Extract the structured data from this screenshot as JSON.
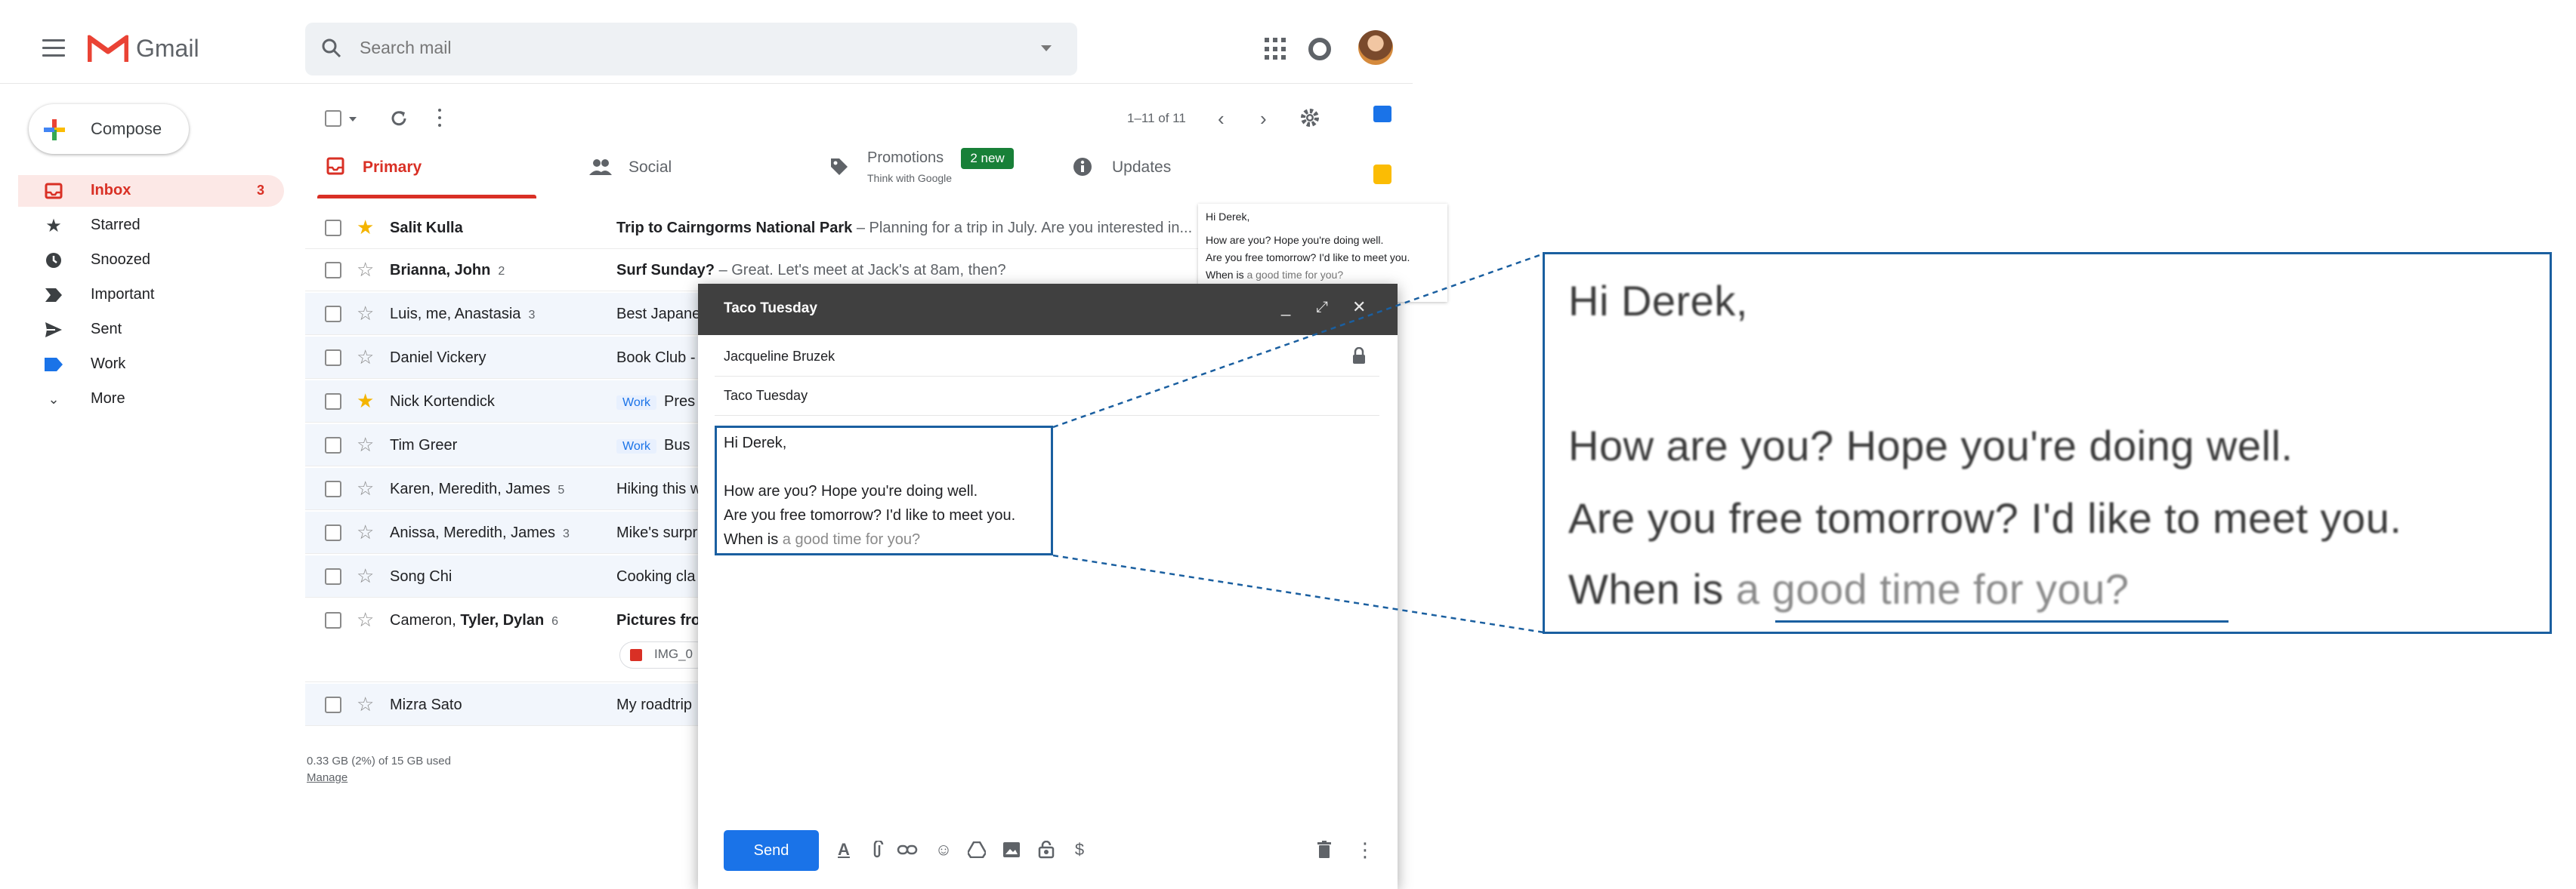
{
  "app": {
    "brand": "Gmail",
    "logo_letter": "M"
  },
  "search": {
    "placeholder": "Search mail"
  },
  "sidebar": {
    "compose_label": "Compose",
    "items": [
      {
        "label": "Inbox",
        "count": "3",
        "icon": "inbox-icon"
      },
      {
        "label": "Starred",
        "icon": "star-icon"
      },
      {
        "label": "Snoozed",
        "icon": "clock-icon"
      },
      {
        "label": "Important",
        "icon": "important-icon"
      },
      {
        "label": "Sent",
        "icon": "send-icon"
      },
      {
        "label": "Work",
        "icon": "label-icon"
      },
      {
        "label": "More",
        "icon": "chevron-down-icon"
      }
    ]
  },
  "toolbar": {
    "pagination": "1–11 of 11"
  },
  "tabs": [
    {
      "label": "Primary"
    },
    {
      "label": "Social"
    },
    {
      "label": "Promotions",
      "badge": "2 new",
      "sub": "Think with Google"
    },
    {
      "label": "Updates"
    }
  ],
  "emails": [
    {
      "sender": "Salit Kulla",
      "count": "",
      "starred": true,
      "unread": true,
      "label": "",
      "subject": "Trip to Cairngorms National Park",
      "snippet": " – Planning for a trip in July. Are you interested in..."
    },
    {
      "sender": "Brianna, John",
      "count": "2",
      "starred": false,
      "unread": true,
      "label": "",
      "subject": "Surf Sunday?",
      "snippet": " – Great. Let's meet at Jack's at 8am, then?"
    },
    {
      "sender": "Luis, me, Anastasia",
      "count": "3",
      "starred": false,
      "unread": false,
      "label": "",
      "subject": "Best Japane",
      "snippet": ""
    },
    {
      "sender": "Daniel Vickery",
      "count": "",
      "starred": false,
      "unread": false,
      "label": "",
      "subject": "Book Club -",
      "snippet": ""
    },
    {
      "sender": "Nick Kortendick",
      "count": "",
      "starred": true,
      "unread": false,
      "label": "Work",
      "subject": "Pres",
      "snippet": ""
    },
    {
      "sender": "Tim Greer",
      "count": "",
      "starred": false,
      "unread": false,
      "label": "Work",
      "subject": "Bus",
      "snippet": ""
    },
    {
      "sender": "Karen, Meredith, James",
      "count": "5",
      "starred": false,
      "unread": false,
      "label": "",
      "subject": "Hiking this w",
      "snippet": ""
    },
    {
      "sender": "Anissa, Meredith, James",
      "count": "3",
      "starred": false,
      "unread": false,
      "label": "",
      "subject": "Mike's surpr",
      "snippet": ""
    },
    {
      "sender": "Song Chi",
      "count": "",
      "starred": false,
      "unread": false,
      "label": "",
      "subject": "Cooking cla",
      "snippet": ""
    },
    {
      "sender_plain": "Cameron, ",
      "sender_bold": "Tyler, Dylan",
      "sender": "Cameron, Tyler, Dylan",
      "count": "6",
      "starred": false,
      "unread": true,
      "label": "",
      "subject": "Pictures fro",
      "snippet": "",
      "attachment": "IMG_0"
    },
    {
      "sender": "Mizra Sato",
      "count": "",
      "starred": false,
      "unread": false,
      "label": "",
      "subject": "My roadtrip",
      "snippet": ""
    }
  ],
  "storage": {
    "used": "0.33 GB (2%) of 15 GB used",
    "manage": "Manage"
  },
  "preview": {
    "greeting": "Hi Derek,",
    "line1": "How are you? Hope you're doing well.",
    "line2": "Are you free tomorrow? I'd like to meet you.",
    "line3_typed": "When is",
    "line3_suggested": " a good time for you?"
  },
  "compose": {
    "title": "Taco Tuesday",
    "to": "Jacqueline Bruzek",
    "subject": "Taco Tuesday",
    "send_label": "Send",
    "body": {
      "greeting": "Hi Derek,",
      "line1": "How are you? Hope you're doing well.",
      "line2": "Are you free tomorrow? I'd like to meet you.",
      "line3_typed": "When is",
      "line3_suggested": " a good time for you?"
    }
  },
  "zoom": {
    "greeting": "Hi Derek,",
    "line1": "How are you? Hope you're doing well.",
    "line2": "Are you free tomorrow? I'd like to meet you.",
    "line3_typed": "When is",
    "line3_suggested": " a good time for you?"
  },
  "colors": {
    "accent_red": "#d93025",
    "primary_blue": "#1a73e8",
    "callout_blue": "#1a5fa0",
    "compose_header": "#404040",
    "badge_green": "#188038"
  }
}
